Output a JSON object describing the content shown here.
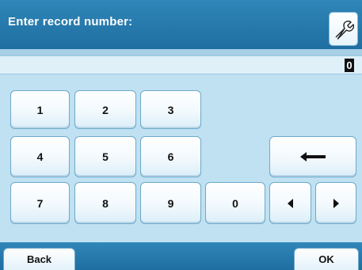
{
  "header": {
    "title": "Enter record number:",
    "tool_icon": "wrench-icon"
  },
  "entry": {
    "value": "0"
  },
  "keypad": {
    "digits": [
      "1",
      "2",
      "3",
      "4",
      "5",
      "6",
      "7",
      "8",
      "9",
      "0"
    ],
    "backspace_icon": "backspace-arrow-icon",
    "left_icon": "cursor-left-icon",
    "right_icon": "cursor-right-icon"
  },
  "footer": {
    "back_label": "Back",
    "ok_label": "OK"
  },
  "colors": {
    "header": "#1f6ea1",
    "background": "#bfe1f2",
    "key_border": "#6fa9c9"
  }
}
